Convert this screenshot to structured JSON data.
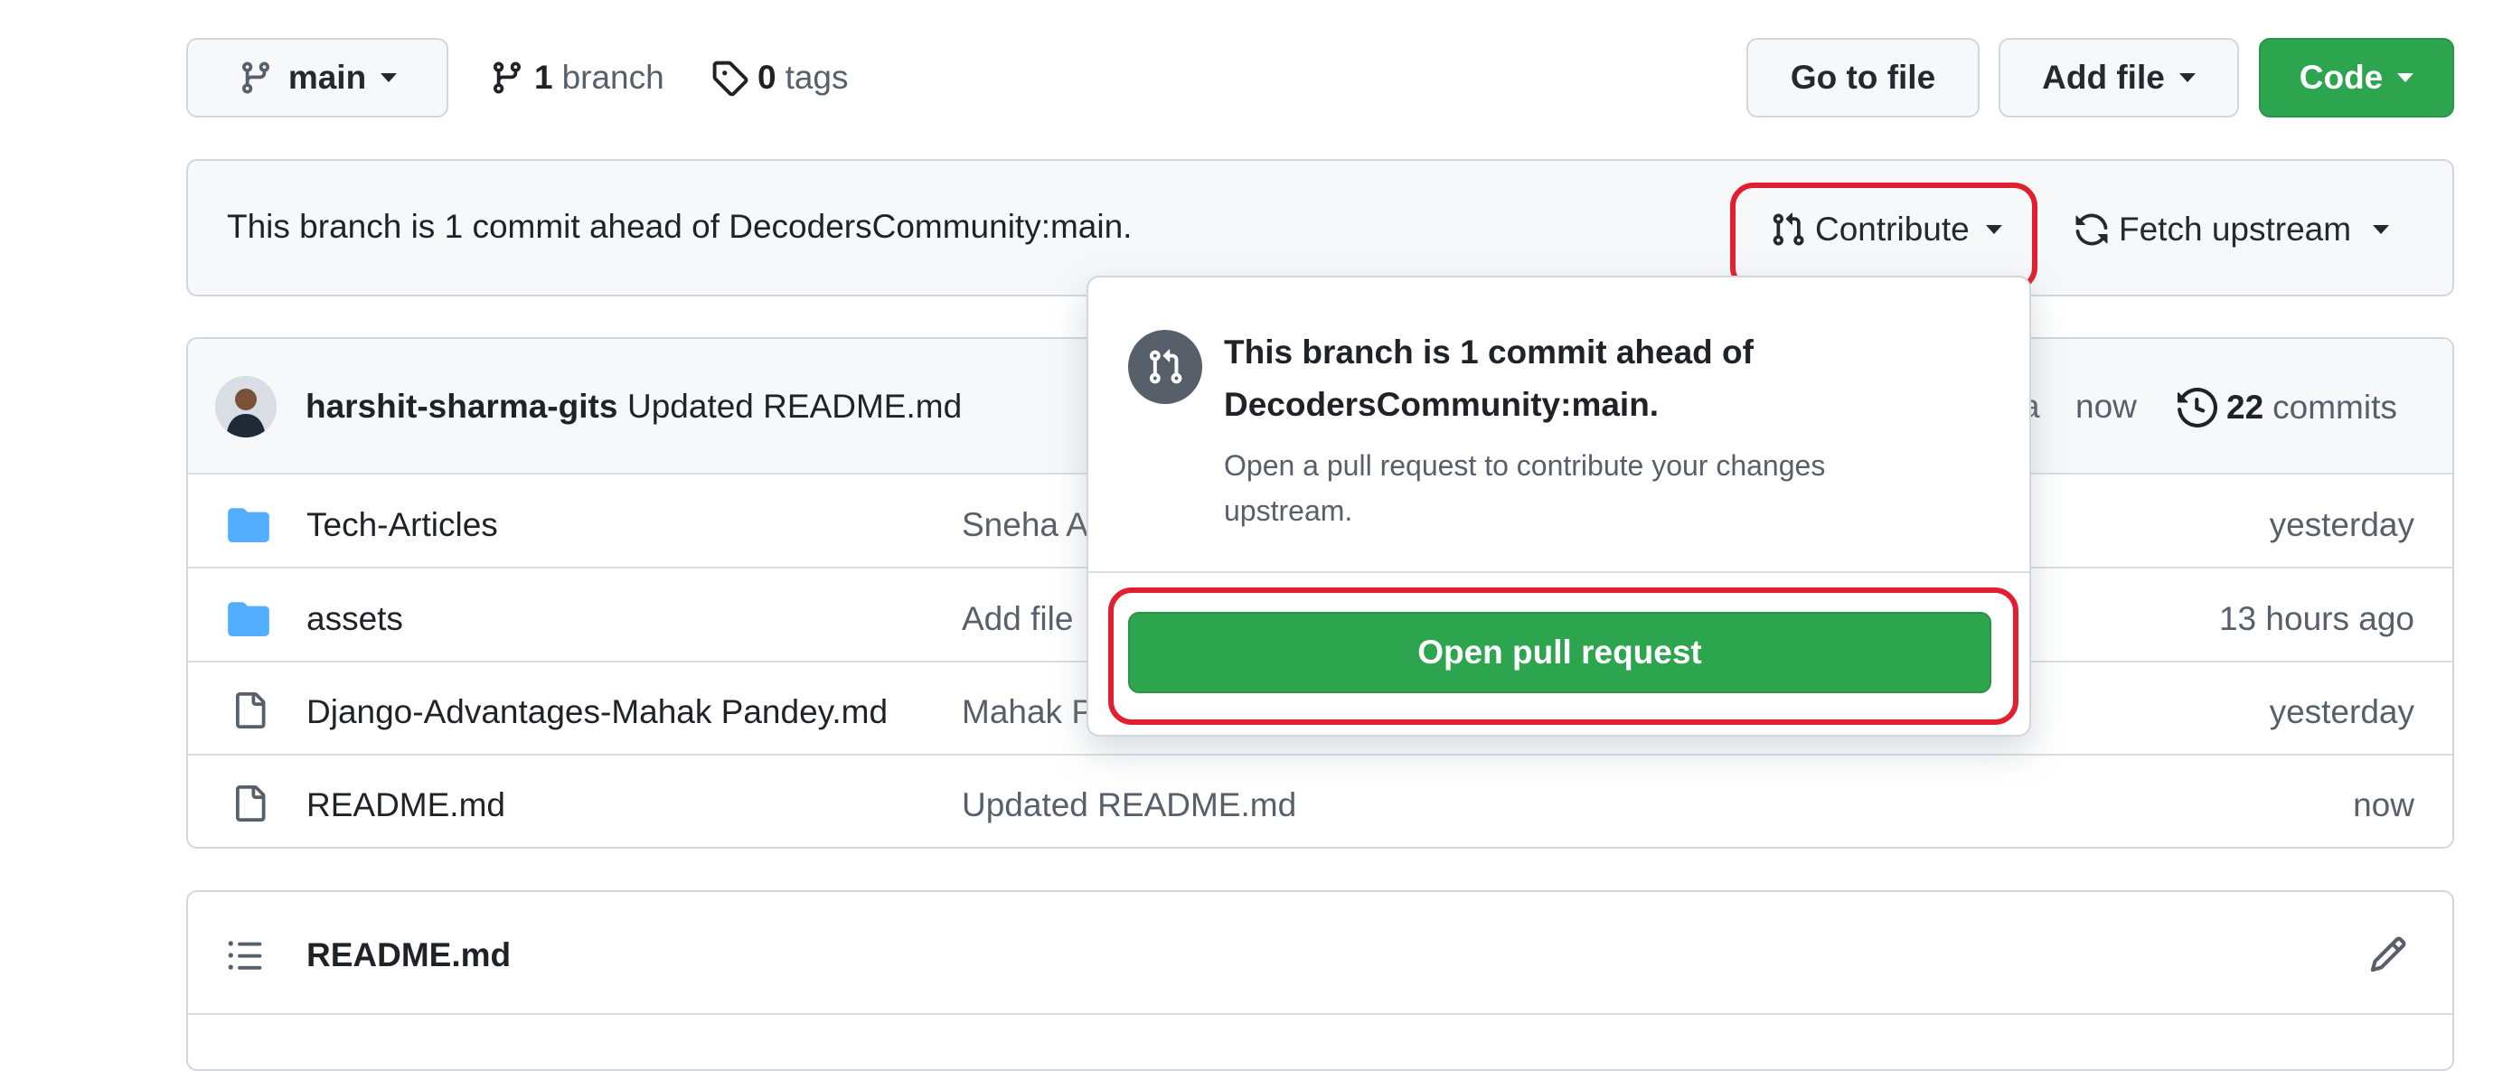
{
  "branch_bar": {
    "branch_name": "main",
    "branch_count": "1",
    "branch_word": "branch",
    "tag_count": "0",
    "tag_word": "tags",
    "go_to_file": "Go to file",
    "add_file": "Add file",
    "code": "Code"
  },
  "ahead_bar": {
    "message": "This branch is 1 commit ahead of DecodersCommunity:main.",
    "contribute": "Contribute",
    "fetch_upstream": "Fetch upstream"
  },
  "commit_header": {
    "author": "harshit-sharma-gits",
    "message": "Updated README.md",
    "hash_fragment": "a",
    "time": "now",
    "commit_count": "22",
    "commits_word": "commits"
  },
  "files": [
    {
      "icon": "folder-icon",
      "name": "Tech-Articles",
      "message": "Sneha A",
      "time": "yesterday"
    },
    {
      "icon": "folder-icon",
      "name": "assets",
      "message": "Add file",
      "time": "13 hours ago"
    },
    {
      "icon": "file-icon",
      "name": "Django-Advantages-Mahak Pandey.md",
      "message": "Mahak P",
      "time": "yesterday"
    },
    {
      "icon": "file-icon",
      "name": "README.md",
      "message": "Updated README.md",
      "time": "now"
    }
  ],
  "readme": {
    "title": "README.md"
  },
  "popover": {
    "title_line1": "This branch is 1 commit ahead of",
    "title_line2": "DecodersCommunity:main.",
    "description_line1": "Open a pull request to contribute your changes",
    "description_line2": "upstream.",
    "open_pr": "Open pull request"
  },
  "colors": {
    "green": "#2da44e",
    "folder": "#54aeff",
    "highlight": "#e0202e",
    "border": "#d0d7de"
  }
}
